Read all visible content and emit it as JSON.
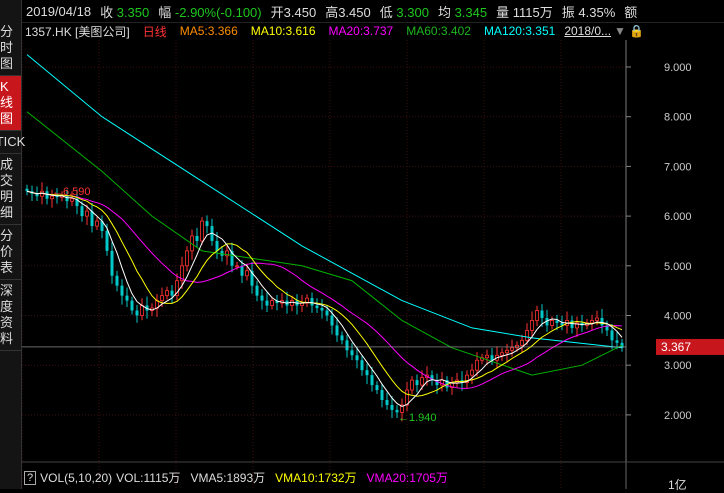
{
  "sidebar": {
    "tabs": [
      {
        "label": "分时图",
        "active": false
      },
      {
        "label": "K线图",
        "active": true
      },
      {
        "label": "TICK",
        "active": false
      },
      {
        "label": "成交明细",
        "active": false
      },
      {
        "label": "分价表",
        "active": false
      },
      {
        "label": "深度资料",
        "active": false
      }
    ]
  },
  "quote": {
    "date": "2019/04/18",
    "close_label": "收",
    "close": "3.350",
    "change_label": "幅",
    "change": "-2.90%(-0.100)",
    "open_label": "开",
    "open": "3.450",
    "high_label": "高",
    "high": "3.450",
    "low_label": "低",
    "low": "3.300",
    "avg_label": "均",
    "avg": "3.345",
    "volume_label": "量",
    "volume": "1115万",
    "amplitude_label": "振",
    "amplitude": "4.35%",
    "amount_label": "额"
  },
  "ma_bar": {
    "symbol": "1357.HK",
    "name": "[美图公司]",
    "period": "日线",
    "ma5": "MA5:3.366",
    "ma10": "MA10:3.616",
    "ma20": "MA20:3.737",
    "ma60": "MA60:3.402",
    "ma120": "MA120:3.351",
    "date_range": "2018/0..."
  },
  "volume_bar": {
    "help": "?",
    "indicator": "VOL(5,10,20)",
    "vol": "VOL:1115万",
    "vma5": "VMA5:1893万",
    "vma10": "VMA10:1732万",
    "vma20": "VMA20:1705万",
    "axis_label": "1亿"
  },
  "colors": {
    "up": "#ff3232",
    "down": "#00c8c8",
    "ma5": "#ffffff",
    "ma10": "#ffff00",
    "ma20": "#ff00ff",
    "ma60": "#00b400",
    "ma120": "#00ffff"
  },
  "chart_data": {
    "type": "candlestick",
    "yticks": [
      "9.000",
      "8.000",
      "7.000",
      "6.000",
      "5.000",
      "4.000",
      "3.000",
      "2.000"
    ],
    "ylim": [
      2,
      9
    ],
    "current_price": "3.367",
    "high_mark": "6.590",
    "low_mark": "1.940",
    "closes": [
      6.5,
      6.45,
      6.4,
      6.5,
      6.35,
      6.4,
      6.38,
      6.42,
      6.3,
      6.35,
      6.2,
      6.0,
      6.1,
      5.8,
      5.9,
      5.7,
      5.3,
      4.8,
      4.6,
      4.4,
      4.3,
      4.1,
      4.0,
      4.2,
      4.1,
      4.15,
      4.3,
      4.4,
      4.5,
      4.4,
      4.7,
      5.0,
      5.3,
      5.6,
      5.5,
      5.9,
      5.8,
      5.5,
      5.3,
      5.2,
      5.3,
      5.0,
      5.0,
      4.8,
      4.9,
      4.6,
      4.4,
      4.3,
      4.2,
      4.3,
      4.25,
      4.3,
      4.2,
      4.3,
      4.2,
      4.25,
      4.35,
      4.2,
      4.15,
      4.1,
      4.0,
      3.8,
      3.6,
      3.5,
      3.3,
      3.2,
      3.1,
      2.9,
      2.8,
      2.6,
      2.5,
      2.3,
      2.2,
      2.1,
      2.05,
      2.2,
      2.5,
      2.7,
      2.6,
      2.75,
      2.8,
      2.7,
      2.6,
      2.7,
      2.55,
      2.65,
      2.7,
      2.65,
      2.8,
      2.9,
      3.1,
      3.15,
      3.2,
      3.1,
      3.2,
      3.25,
      3.3,
      3.35,
      3.4,
      3.5,
      3.7,
      3.9,
      4.1,
      3.95,
      3.8,
      3.9,
      3.85,
      3.8,
      3.9,
      3.75,
      3.85,
      3.8,
      3.85,
      3.9,
      3.95,
      3.8,
      3.7,
      3.5,
      3.45,
      3.35
    ],
    "ma60": [
      8.1,
      6.9,
      6.0,
      5.3,
      5.0,
      4.7,
      3.9,
      3.35,
      2.8,
      3.0,
      3.4
    ],
    "ma60_idx": [
      0,
      15,
      25,
      35,
      55,
      65,
      75,
      85,
      101,
      111,
      119
    ],
    "ma120": [
      9.25,
      8.0,
      6.7,
      5.4,
      4.3,
      3.75,
      3.55,
      3.35
    ],
    "ma120_idx": [
      0,
      15,
      35,
      55,
      75,
      89,
      101,
      119
    ]
  }
}
